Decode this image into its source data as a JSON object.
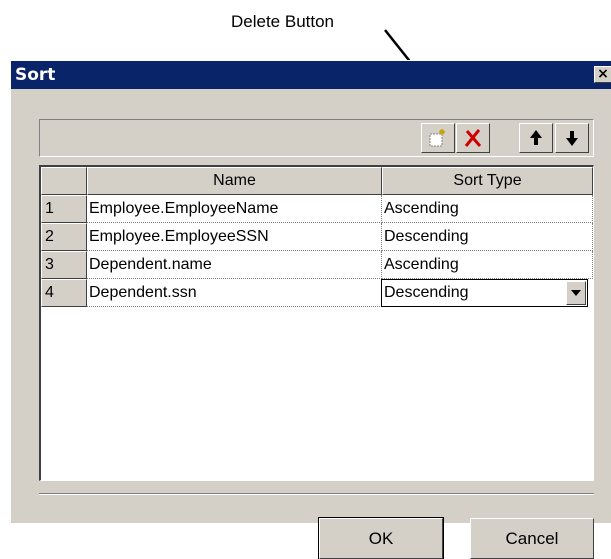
{
  "annotation": {
    "callout_text": "Delete Button"
  },
  "dialog": {
    "title": "Sort",
    "close_symbol": "×",
    "toolbar": {
      "buttons": [
        {
          "name": "new-row",
          "icon": "new-sparkle-icon"
        },
        {
          "name": "delete",
          "icon": "red-x-icon",
          "color": "#d00000"
        },
        {
          "name": "move-up",
          "icon": "arrow-up-icon"
        },
        {
          "name": "move-down",
          "icon": "arrow-down-icon"
        }
      ]
    },
    "grid": {
      "columns": [
        "Name",
        "Sort Type"
      ],
      "rows": [
        {
          "num": "1",
          "name": "Employee.EmployeeName",
          "sort_type": "Ascending"
        },
        {
          "num": "2",
          "name": "Employee.EmployeeSSN",
          "sort_type": "Descending"
        },
        {
          "num": "3",
          "name": "Dependent.name",
          "sort_type": "Ascending"
        },
        {
          "num": "4",
          "name": "Dependent.ssn",
          "sort_type": "Descending"
        }
      ]
    },
    "buttons": {
      "ok": "OK",
      "cancel": "Cancel"
    }
  },
  "colors": {
    "titlebar": "#0a246a",
    "face": "#d4d0c8",
    "delete_icon": "#d00000"
  }
}
